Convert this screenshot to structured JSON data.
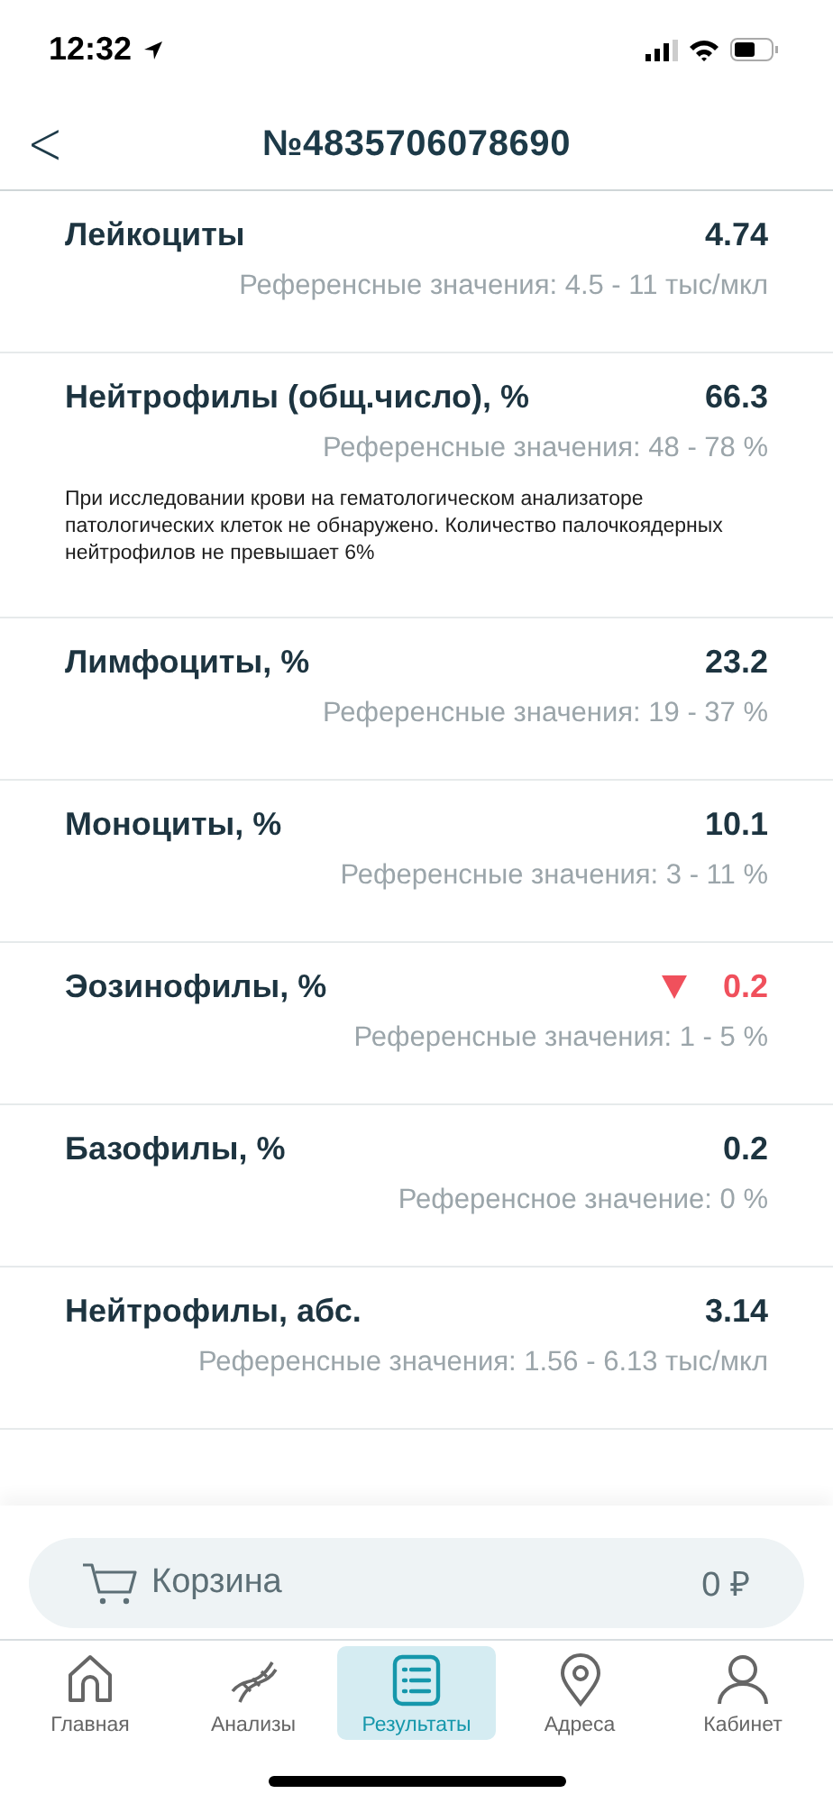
{
  "status_bar": {
    "time": "12:32"
  },
  "header": {
    "back": "<",
    "title": "№4835706078690"
  },
  "results": [
    {
      "name": "Лейкоциты",
      "value": "4.74",
      "reference": "Референсные значения: 4.5 - 11 тыс/мкл",
      "below_range": false
    },
    {
      "name": "Нейтрофилы (общ.число), %",
      "value": "66.3",
      "reference": "Референсные значения: 48 - 78 %",
      "note": "При исследовании крови на гематологическом анализаторе патологических клеток не обнаружено. Количество палочкоядерных нейтрофилов не превышает 6%",
      "below_range": false
    },
    {
      "name": "Лимфоциты, %",
      "value": "23.2",
      "reference": "Референсные значения: 19 - 37 %",
      "below_range": false
    },
    {
      "name": "Моноциты, %",
      "value": "10.1",
      "reference": "Референсные значения: 3 - 11 %",
      "below_range": false
    },
    {
      "name": "Эозинофилы, %",
      "value": "0.2",
      "reference": "Референсные значения: 1 - 5 %",
      "below_range": true
    },
    {
      "name": "Базофилы, %",
      "value": "0.2",
      "reference": "Референсное значение: 0 %",
      "below_range": false
    },
    {
      "name": "Нейтрофилы, абс.",
      "value": "3.14",
      "reference": "Референсные значения: 1.56 - 6.13 тыс/мкл",
      "below_range": false
    }
  ],
  "cart": {
    "label": "Корзина",
    "total": "0 ₽"
  },
  "tabs": [
    {
      "label": "Главная",
      "kind": "home",
      "selected": false
    },
    {
      "label": "Анализы",
      "kind": "dna",
      "selected": false
    },
    {
      "label": "Результаты",
      "kind": "list",
      "selected": true
    },
    {
      "label": "Адреса",
      "kind": "pin",
      "selected": false
    },
    {
      "label": "Кабинет",
      "kind": "person",
      "selected": false
    }
  ]
}
